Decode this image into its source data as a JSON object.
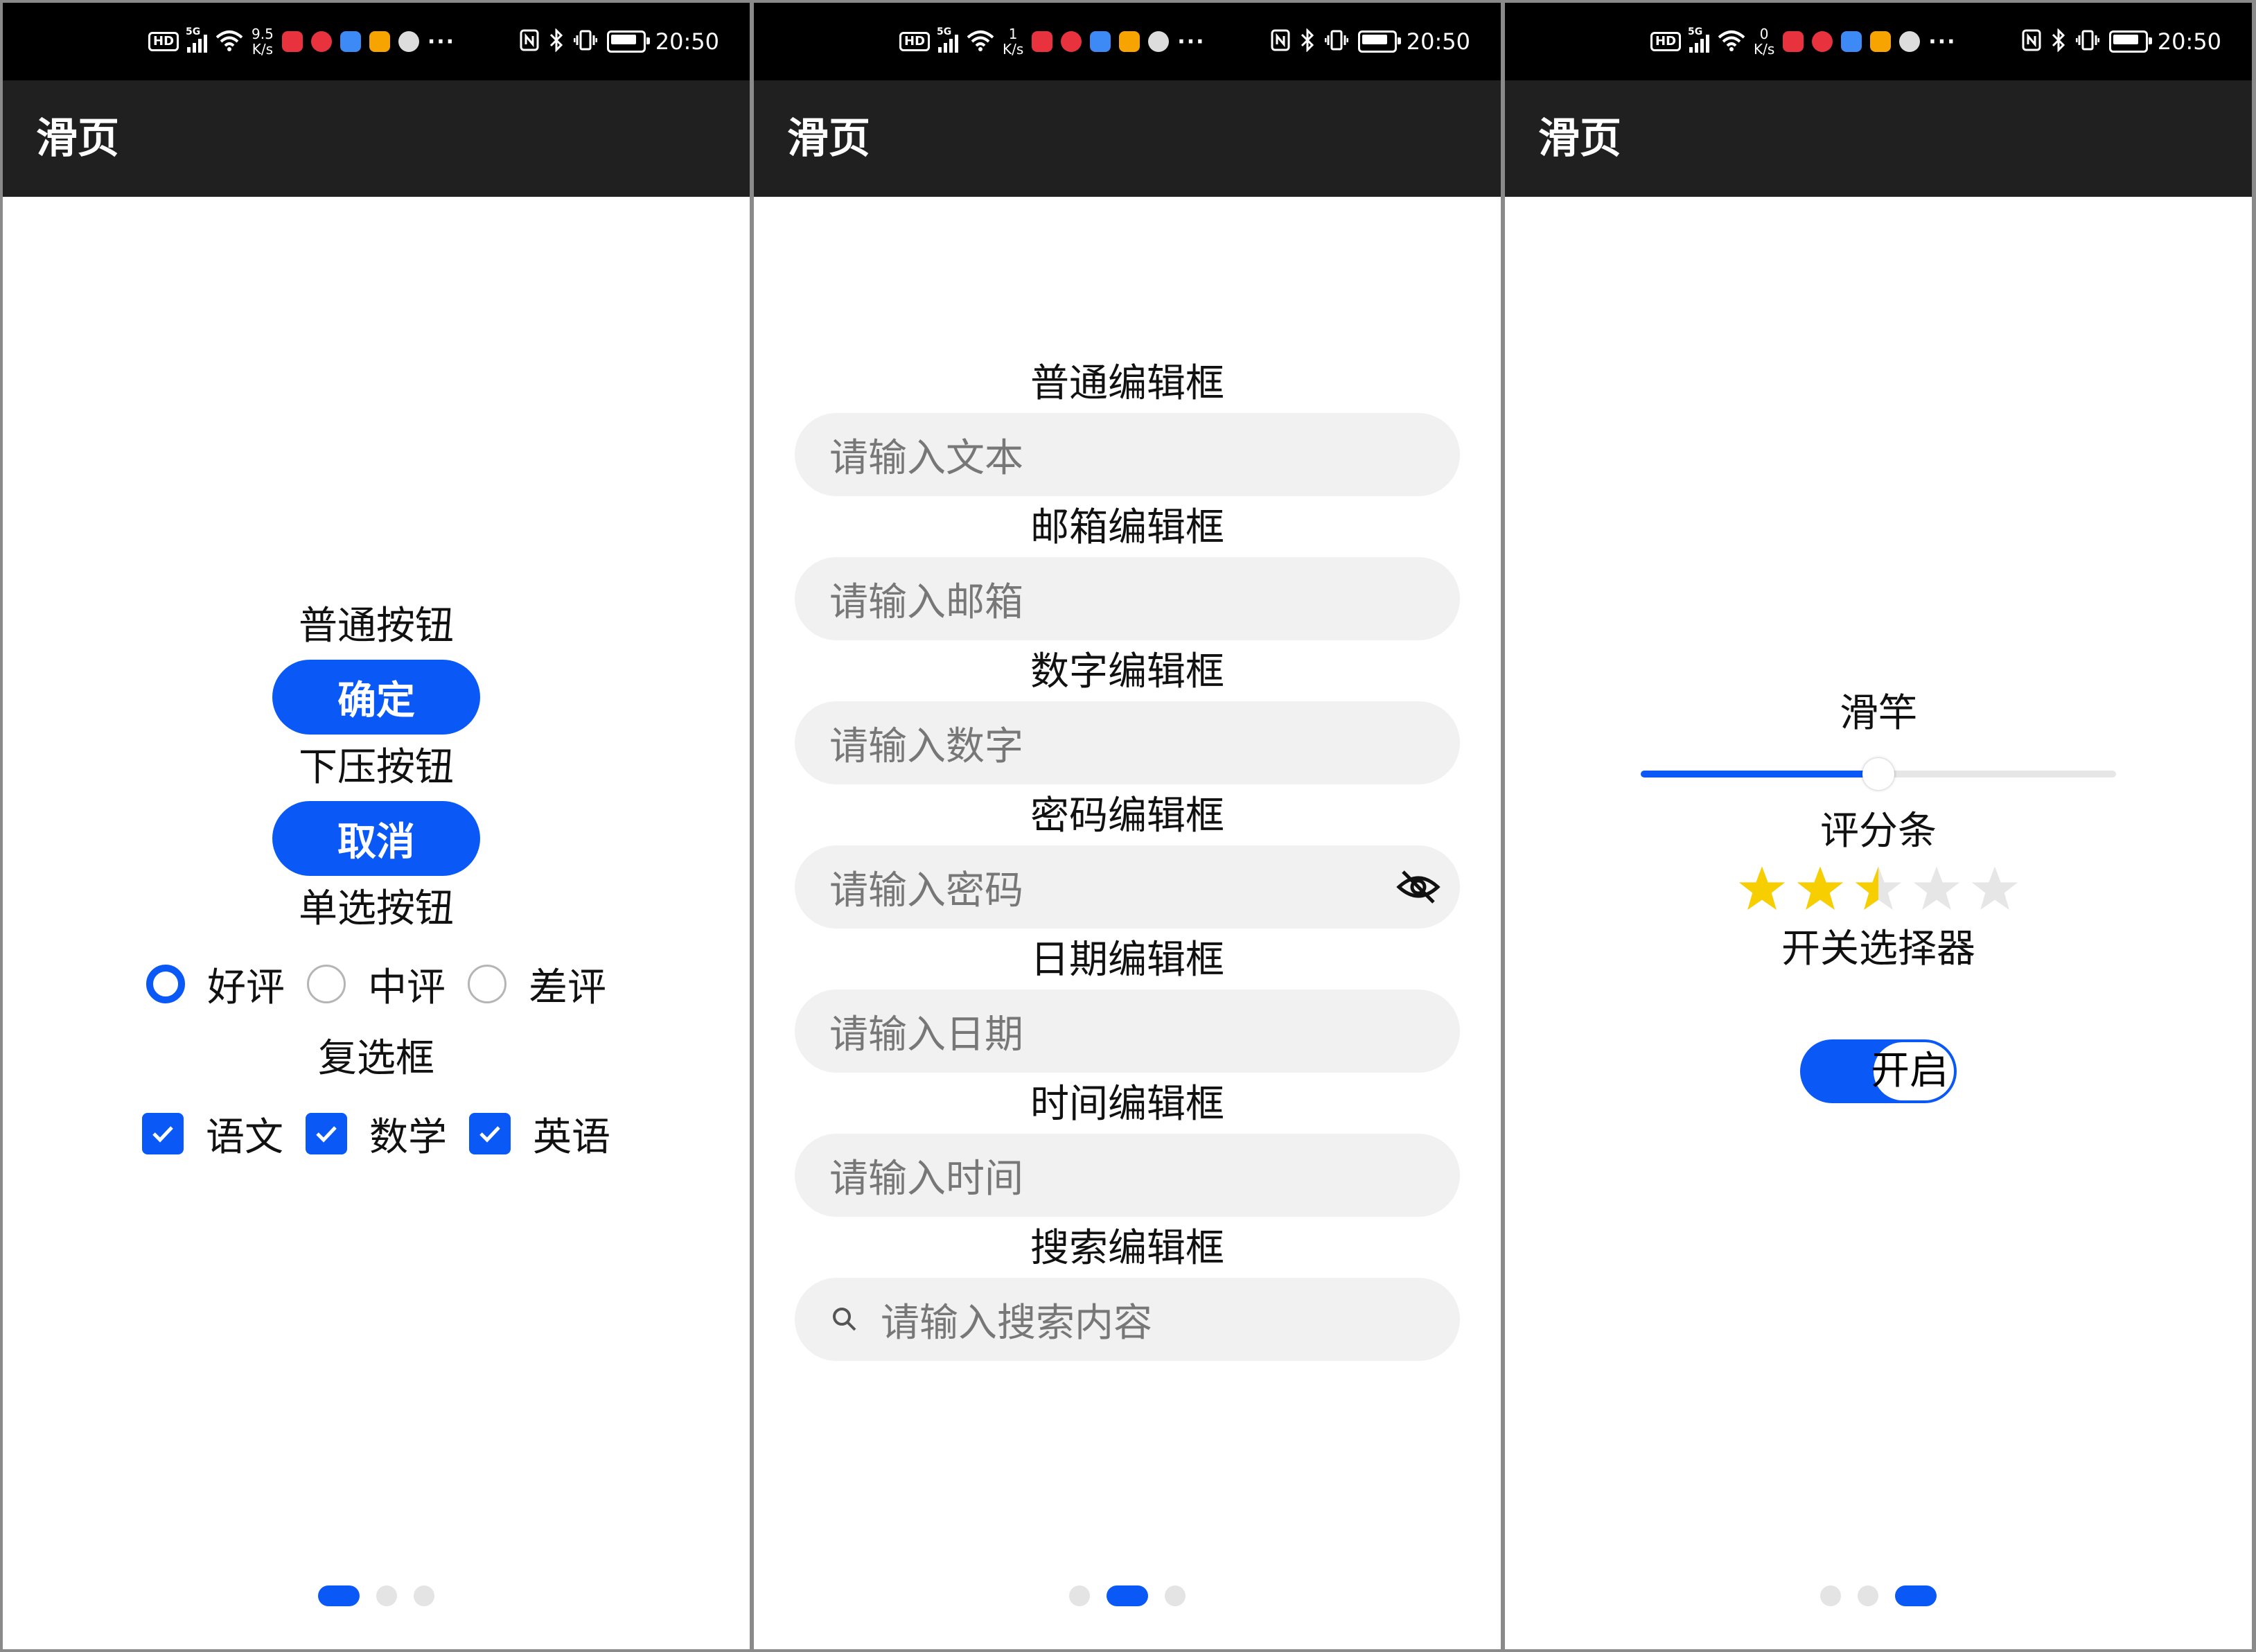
{
  "accent_color": "#0a59f7",
  "status_bar": {
    "time": "20:50",
    "network_gen": "5G",
    "hd_label": "HD",
    "speed_unit": "K/s",
    "speeds": [
      "9.5",
      "1",
      "0"
    ],
    "icons": [
      "hd-icon",
      "signal-icon",
      "wifi-icon",
      "app-notification-icons",
      "more-dots-icon",
      "nfc-icon",
      "bluetooth-icon",
      "vibrate-icon",
      "battery-icon"
    ],
    "more": "···"
  },
  "app_title": "滑页",
  "pages": [
    {
      "normal_button_label": "普通按钮",
      "confirm_button": "确定",
      "press_button_label": "下压按钮",
      "cancel_button": "取消",
      "radio_label": "单选按钮",
      "radios": [
        {
          "text": "好评",
          "checked": true
        },
        {
          "text": "中评",
          "checked": false
        },
        {
          "text": "差评",
          "checked": false
        }
      ],
      "checkbox_label": "复选框",
      "checkboxes": [
        {
          "text": "语文",
          "checked": true
        },
        {
          "text": "数学",
          "checked": true
        },
        {
          "text": "英语",
          "checked": true
        }
      ]
    },
    {
      "fields": [
        {
          "label": "普通编辑框",
          "placeholder": "请输入文本"
        },
        {
          "label": "邮箱编辑框",
          "placeholder": "请输入邮箱"
        },
        {
          "label": "数字编辑框",
          "placeholder": "请输入数字"
        },
        {
          "label": "密码编辑框",
          "placeholder": "请输入密码",
          "icon": "eye-off-icon"
        },
        {
          "label": "日期编辑框",
          "placeholder": "请输入日期"
        },
        {
          "label": "时间编辑框",
          "placeholder": "请输入时间"
        },
        {
          "label": "搜索编辑框",
          "placeholder": "请输入搜索内容",
          "icon": "search-icon"
        }
      ]
    },
    {
      "slider_label": "滑竿",
      "slider_value": 0.5,
      "rating_label": "评分条",
      "rating": 2.5,
      "rating_max": 5,
      "star_color": "#f7ce00",
      "switch_label": "开关选择器",
      "switch_text": "开启",
      "switch_on": true
    }
  ],
  "page_indicator": {
    "count": 3
  }
}
